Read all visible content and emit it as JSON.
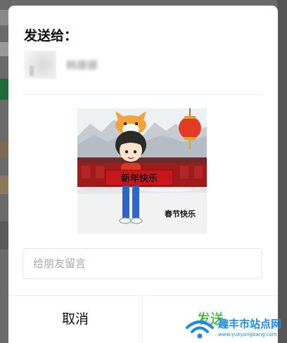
{
  "dialog": {
    "title": "发送给：",
    "recipient": {
      "name": "韩娜娜"
    },
    "sticker": {
      "caption": "春节快乐",
      "banner_text": "新年快乐"
    },
    "message": {
      "placeholder": "给朋友留言",
      "value": ""
    },
    "buttons": {
      "cancel": "取消",
      "send": "发送"
    }
  },
  "watermark": {
    "title": "趣丰市站点网",
    "url": "www.yueyangbang.com"
  },
  "colors": {
    "send": "#1aad19",
    "watermark": "#1e88e5"
  }
}
